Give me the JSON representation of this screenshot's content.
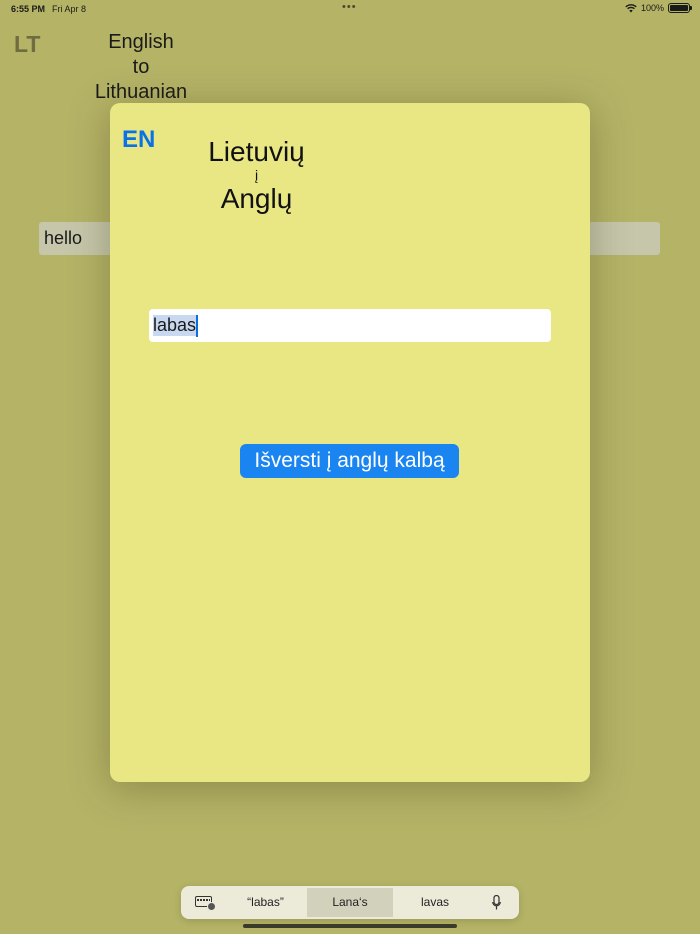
{
  "status_bar": {
    "time": "6:55 PM",
    "date": "Fri Apr 8",
    "dots": "•••",
    "battery": "100%"
  },
  "background_screen": {
    "lang_label": "LT",
    "title": {
      "line1": "English",
      "line2": "to",
      "line3": "Lithuanian"
    },
    "input_value": "hello"
  },
  "sheet": {
    "lang_button": "EN",
    "title": {
      "line1": "Lietuvių",
      "line2": "į",
      "line3": "Anglų"
    },
    "input_value": "labas",
    "translate_button": "Išversti į anglų kalbą"
  },
  "suggestions": [
    "“labas”",
    "Lana‘s",
    "lavas"
  ],
  "colors": {
    "background": "#b5b366",
    "sheet": "#e8e784",
    "accent": "#1a84f0",
    "lang_button": "#0a72e6"
  },
  "icons": {
    "keyboard": "keyboard-icon",
    "mic": "mic-icon",
    "wifi": "wifi-icon",
    "battery": "battery-icon"
  }
}
